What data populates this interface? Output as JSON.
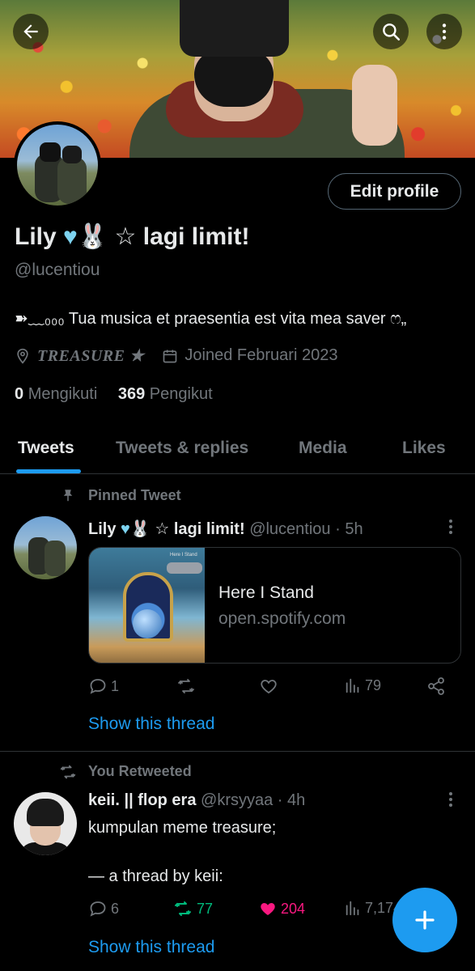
{
  "header": {
    "back_icon": "arrow-left-icon",
    "search_icon": "search-icon",
    "more_icon": "more-vertical-icon"
  },
  "profile": {
    "name": "Lily",
    "name_suffix": " ☆ lagi limit!",
    "handle": "@lucentiou",
    "bio": "➽﹏₀₀₀ Tua musica et praesentia est vita mea saver ෆ„",
    "location": "TREASURE ★",
    "joined": "Joined Februari 2023",
    "following_count": "0",
    "following_label": "Mengikuti",
    "followers_count": "369",
    "followers_label": "Pengikut",
    "edit_label": "Edit profile",
    "heart_color": "#7dd3f0"
  },
  "tabs": [
    "Tweets",
    "Tweets & replies",
    "Media",
    "Likes"
  ],
  "tweets": [
    {
      "context": "Pinned Tweet",
      "context_icon": "pin-icon",
      "author": "Lily",
      "author_suffix": " ☆ lagi limit!",
      "handle_time": "@lucentiou · 5h",
      "card": {
        "title": "Here I Stand",
        "domain": "open.spotify.com",
        "art_caption": "Here I Stand"
      },
      "replies": "1",
      "retweets": "",
      "likes": "",
      "views": "79",
      "show_thread": "Show this thread"
    },
    {
      "context": "You Retweeted",
      "context_icon": "retweet-icon",
      "author": "keii. || flop era",
      "handle_time": "@krsyyaa · 4h",
      "text_line1": "kumpulan meme treasure;",
      "text_line2": "— a thread by keii:",
      "replies": "6",
      "retweets": "77",
      "likes": "204",
      "views": "7,174",
      "show_thread": "Show this thread"
    }
  ],
  "fab_icon": "plus-icon",
  "colors": {
    "accent": "#1d9bf0",
    "retweet_active": "#00ba7c",
    "like_active": "#f91880",
    "muted": "#71767b",
    "background": "#000000"
  }
}
